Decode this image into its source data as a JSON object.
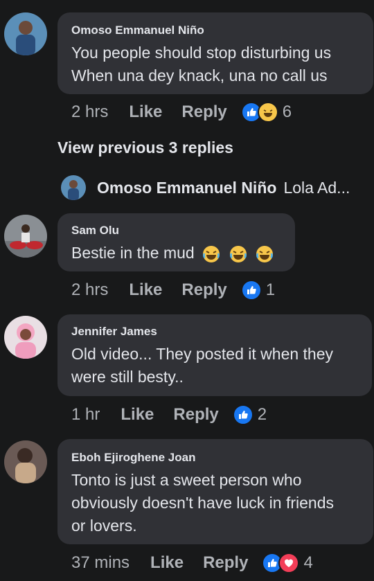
{
  "comments": [
    {
      "author": "Omoso Emmanuel Niño",
      "text_lines": [
        "You people should stop disturbing us",
        "When una dey knack, una no call us"
      ],
      "time": "2 hrs",
      "like_label": "Like",
      "reply_label": "Reply",
      "reactions": [
        "like",
        "haha"
      ],
      "reaction_count": "6"
    },
    {
      "author": "Sam Olu",
      "text": "Bestie in the mud",
      "text_emojis": [
        "face-with-tears-of-joy",
        "face-with-tears-of-joy",
        "face-with-tears-of-joy"
      ],
      "time": "2 hrs",
      "like_label": "Like",
      "reply_label": "Reply",
      "reactions": [
        "like"
      ],
      "reaction_count": "1"
    },
    {
      "author": "Jennifer James",
      "text_lines": [
        "Old video... They posted it when they",
        "were still besty.."
      ],
      "time": "1 hr",
      "like_label": "Like",
      "reply_label": "Reply",
      "reactions": [
        "like"
      ],
      "reaction_count": "2"
    },
    {
      "author": "Eboh Ejiroghene Joan",
      "text_lines": [
        "Tonto is just a sweet person who",
        "obviously doesn't have luck in friends",
        "or lovers."
      ],
      "time": "37 mins",
      "like_label": "Like",
      "reply_label": "Reply",
      "reactions": [
        "like",
        "love"
      ],
      "reaction_count": "4"
    }
  ],
  "view_previous": "View previous 3 replies",
  "collapsed_reply": {
    "author": "Omoso Emmanuel Niño",
    "preview": "Lola Ad..."
  },
  "colors": {
    "background": "#18191a",
    "bubble": "#303136",
    "text": "#e4e6eb",
    "muted": "#b0b3b8",
    "like_blue": "#1877f2",
    "love_red": "#f33e58",
    "haha_yellow": "#f7c64a"
  }
}
